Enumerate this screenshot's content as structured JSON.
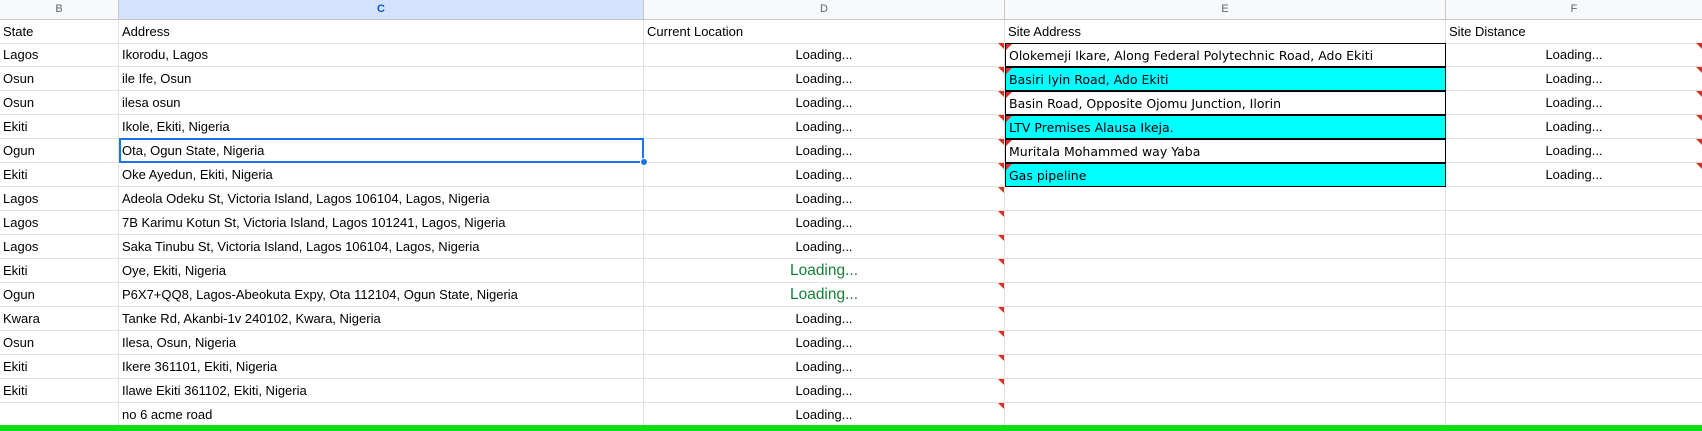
{
  "columns": {
    "b": "B",
    "c": "C",
    "d": "D",
    "e": "E",
    "f": "F"
  },
  "header_row": {
    "state": "State",
    "address": "Address",
    "current_location": "Current Location",
    "site_address": "Site Address",
    "site_distance": "Site Distance"
  },
  "rows": [
    {
      "state": "Lagos",
      "address": "Ikorodu, Lagos",
      "location": "Loading...",
      "site_address": "Olokemeji Ikare, Along Federal Polytechnic Road, Ado Ekiti",
      "site_distance": "Loading..."
    },
    {
      "state": "Osun",
      "address": "ile Ife, Osun",
      "location": "Loading...",
      "site_address": "Basiri Iyin Road, Ado Ekiti",
      "site_distance": "Loading..."
    },
    {
      "state": "Osun",
      "address": "ilesa osun",
      "location": "Loading...",
      "site_address": "Basin Road, Opposite Ojomu Junction, Ilorin",
      "site_distance": "Loading..."
    },
    {
      "state": "Ekiti",
      "address": "Ikole, Ekiti, Nigeria",
      "location": "Loading...",
      "site_address": "LTV Premises Alausa Ikeja.",
      "site_distance": "Loading..."
    },
    {
      "state": "Ogun",
      "address": "Ota, Ogun State, Nigeria",
      "location": "Loading...",
      "site_address": "Muritala Mohammed way Yaba",
      "site_distance": "Loading..."
    },
    {
      "state": "Ekiti",
      "address": "Oke Ayedun, Ekiti, Nigeria",
      "location": "Loading...",
      "site_address": "Gas pipeline",
      "site_distance": "Loading..."
    },
    {
      "state": "Lagos",
      "address": "Adeola Odeku St, Victoria Island, Lagos 106104, Lagos, Nigeria",
      "location": "Loading...",
      "site_address": "",
      "site_distance": ""
    },
    {
      "state": "Lagos",
      "address": "7B Karimu Kotun St, Victoria Island, Lagos 101241, Lagos, Nigeria",
      "location": "Loading...",
      "site_address": "",
      "site_distance": ""
    },
    {
      "state": "Lagos",
      "address": "Saka Tinubu St, Victoria Island, Lagos 106104, Lagos, Nigeria",
      "location": "Loading...",
      "site_address": "",
      "site_distance": ""
    },
    {
      "state": "Ekiti",
      "address": "Oye, Ekiti, Nigeria",
      "location": "Loading...",
      "site_address": "",
      "site_distance": ""
    },
    {
      "state": "Ogun",
      "address": "P6X7+QQ8, Lagos-Abeokuta Expy, Ota 112104, Ogun State, Nigeria",
      "location": "Loading...",
      "site_address": "",
      "site_distance": ""
    },
    {
      "state": "Kwara",
      "address": "Tanke Rd, Akanbi-1v 240102, Kwara, Nigeria",
      "location": "Loading...",
      "site_address": "",
      "site_distance": ""
    },
    {
      "state": "Osun",
      "address": "Ilesa, Osun, Nigeria",
      "location": "Loading...",
      "site_address": "",
      "site_distance": ""
    },
    {
      "state": "Ekiti",
      "address": "Ikere 361101, Ekiti, Nigeria",
      "location": "Loading...",
      "site_address": "",
      "site_distance": ""
    },
    {
      "state": "Ekiti",
      "address": "Ilawe Ekiti 361102, Ekiti, Nigeria",
      "location": "Loading...",
      "site_address": "",
      "site_distance": ""
    },
    {
      "state": "",
      "address": "no 6 acme road",
      "location": "Loading...",
      "site_address": "",
      "site_distance": ""
    }
  ],
  "colors": {
    "selected_header": "#d3e3fd",
    "selection_border": "#1a73e8",
    "site_cyan": "#00ffff",
    "note_marker": "#d93025",
    "loading_green": "#188038",
    "bottom_bar": "#10e010"
  }
}
